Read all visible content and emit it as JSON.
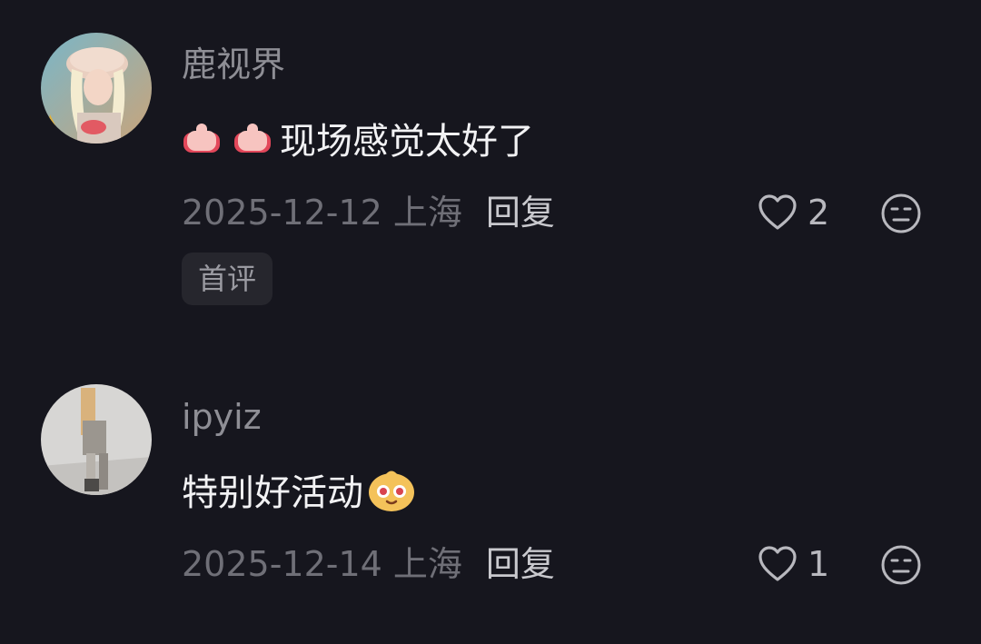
{
  "comments": [
    {
      "username": "鹿视界",
      "avatar_icon": "avatar-photo-woman-hat",
      "emojis": [
        "thumbs-up-icon",
        "thumbs-up-icon"
      ],
      "text": "现场感觉太好了",
      "time_location": "2025-12-12 上海",
      "reply_label": "回复",
      "likes": "2",
      "tag": "首评"
    },
    {
      "username": "ipyiz",
      "avatar_icon": "avatar-photo-figure",
      "text": "特别好活动",
      "emojis": [
        "smiling-face-icon"
      ],
      "time_location": "2025-12-14 上海",
      "reply_label": "回复",
      "likes": "1"
    }
  ],
  "colors": {
    "background": "#16161e",
    "username": "#8e8e95",
    "content": "#f2f2f4",
    "meta": "#6f6f77",
    "tag_bg": "#26262d"
  }
}
